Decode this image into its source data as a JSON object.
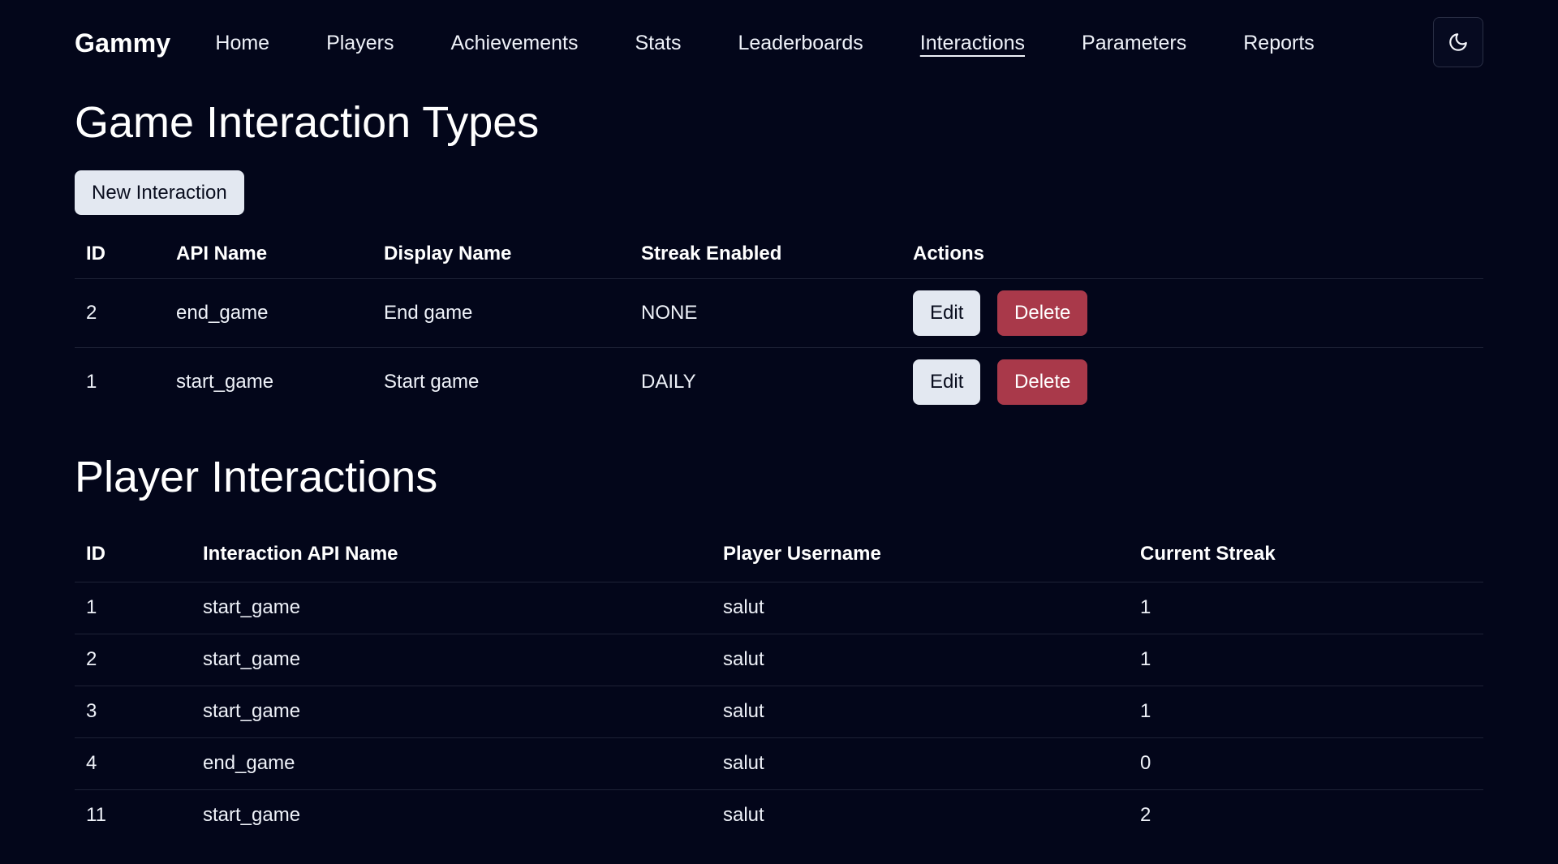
{
  "nav": {
    "brand": "Gammy",
    "links": [
      {
        "label": "Home"
      },
      {
        "label": "Players"
      },
      {
        "label": "Achievements"
      },
      {
        "label": "Stats"
      },
      {
        "label": "Leaderboards"
      },
      {
        "label": "Interactions",
        "active": true
      },
      {
        "label": "Parameters"
      },
      {
        "label": "Reports"
      }
    ],
    "theme_toggle_icon": "moon-icon"
  },
  "interaction_types": {
    "title": "Game Interaction Types",
    "new_button_label": "New Interaction",
    "columns": [
      "ID",
      "API Name",
      "Display Name",
      "Streak Enabled",
      "Actions"
    ],
    "rows": [
      {
        "id": "2",
        "api_name": "end_game",
        "display_name": "End game",
        "streak": "NONE",
        "edit_label": "Edit",
        "delete_label": "Delete"
      },
      {
        "id": "1",
        "api_name": "start_game",
        "display_name": "Start game",
        "streak": "DAILY",
        "edit_label": "Edit",
        "delete_label": "Delete"
      }
    ]
  },
  "player_interactions": {
    "title": "Player Interactions",
    "columns": [
      "ID",
      "Interaction API Name",
      "Player Username",
      "Current Streak"
    ],
    "rows": [
      {
        "id": "1",
        "api_name": "start_game",
        "username": "salut",
        "streak": "1"
      },
      {
        "id": "2",
        "api_name": "start_game",
        "username": "salut",
        "streak": "1"
      },
      {
        "id": "3",
        "api_name": "start_game",
        "username": "salut",
        "streak": "1"
      },
      {
        "id": "4",
        "api_name": "end_game",
        "username": "salut",
        "streak": "0"
      },
      {
        "id": "11",
        "api_name": "start_game",
        "username": "salut",
        "streak": "2"
      }
    ]
  },
  "colors": {
    "background": "#03061a",
    "delete_button": "#a9394a",
    "light_button": "#e3e8f1"
  }
}
